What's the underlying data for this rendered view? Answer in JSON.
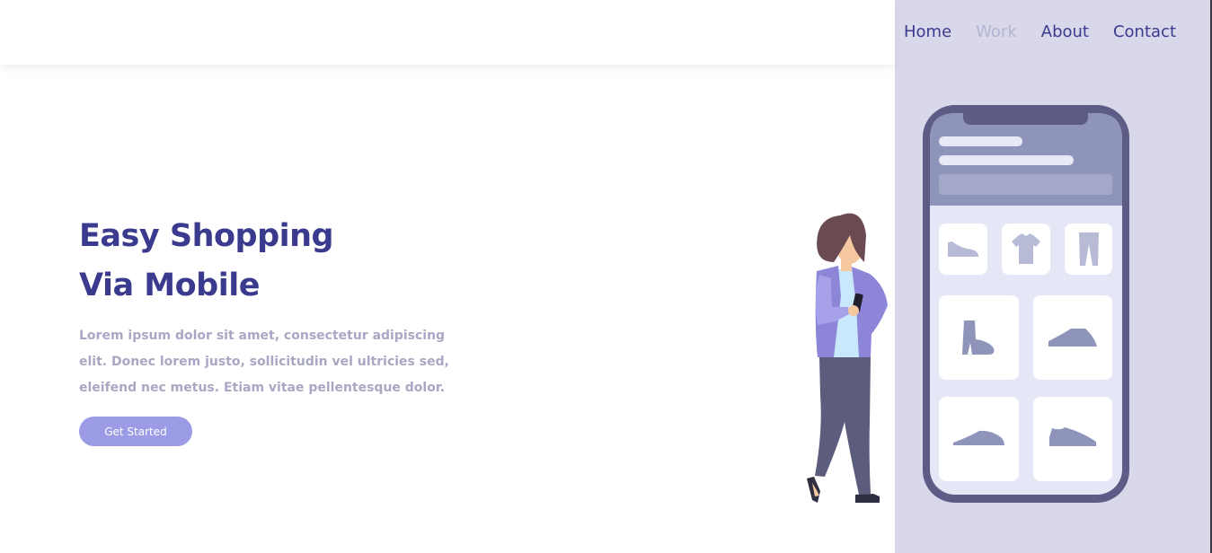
{
  "nav": {
    "items": [
      {
        "label": "Home",
        "active": false
      },
      {
        "label": "Work",
        "active": true
      },
      {
        "label": "About",
        "active": false
      },
      {
        "label": "Contact",
        "active": false
      }
    ]
  },
  "hero": {
    "title_line1": "Easy Shopping",
    "title_line2": "Via Mobile",
    "description": "Lorem ipsum dolor sit amet, consectetur adipiscing elit. Donec lorem justo, sollicitudin vel ultricies sed, eleifend nec metus. Etiam vitae pellentesque dolor.",
    "cta_label": "Get Started"
  },
  "colors": {
    "primary": "#3a3a8e",
    "nav_active": "#b5b4d4",
    "panel_bg": "#d9d8ea",
    "button_bg": "#9b9be6",
    "body_text": "#a9a8c4"
  },
  "illustration": {
    "icons": [
      "sneaker-icon",
      "tshirt-icon",
      "pants-icon",
      "boot-icon",
      "shoe-icon",
      "sneaker-icon",
      "shoe-icon"
    ]
  }
}
